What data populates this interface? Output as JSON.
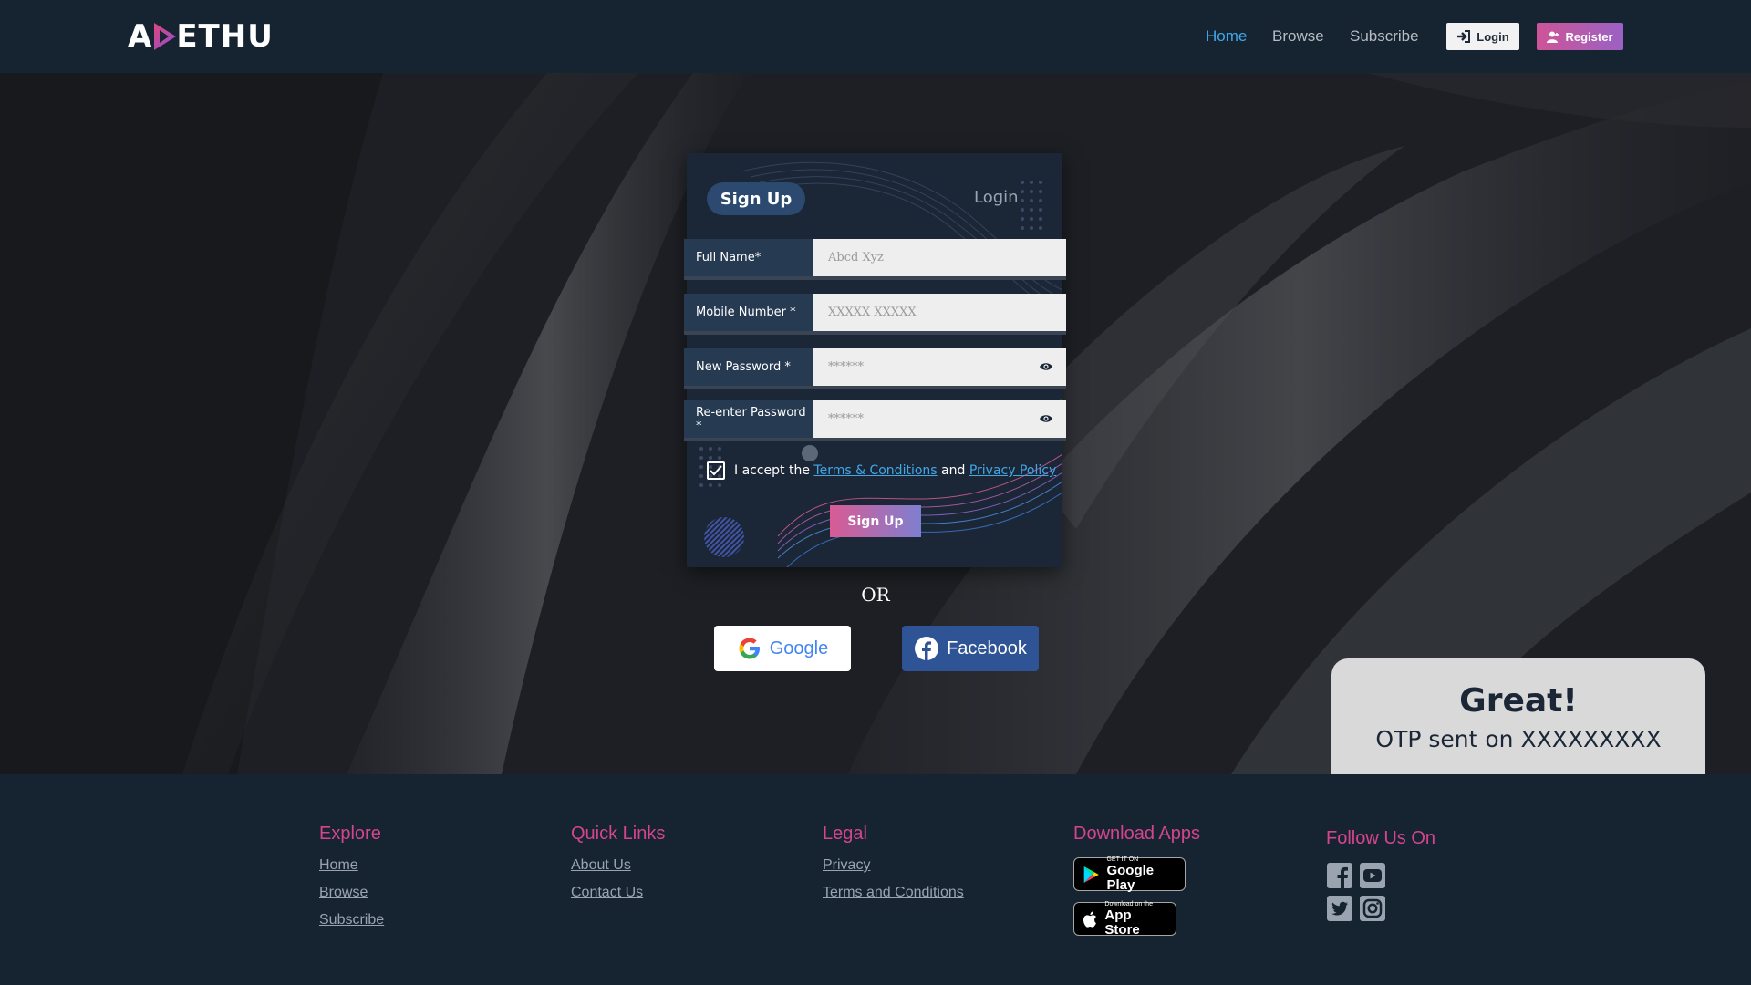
{
  "header": {
    "logo_text_left": "A",
    "logo_text_right": "ETHU",
    "nav": [
      {
        "label": "Home",
        "active": true
      },
      {
        "label": "Browse",
        "active": false
      },
      {
        "label": "Subscribe",
        "active": false
      }
    ],
    "login_label": "Login",
    "register_label": "Register"
  },
  "form": {
    "tab_signup": "Sign Up",
    "tab_login": "Login",
    "fields": [
      {
        "label": "Full Name*",
        "placeholder": "Abcd Xyz"
      },
      {
        "label": "Mobile Number *",
        "placeholder": "XXXXX XXXXX"
      },
      {
        "label": "New Password *",
        "placeholder": "******"
      },
      {
        "label": "Re-enter Password *",
        "placeholder": "******"
      }
    ],
    "terms_prefix": "I accept the",
    "terms_link": "Terms & Conditions",
    "terms_and": "and",
    "privacy_link": "Privacy Policy",
    "checkbox_checked": true,
    "submit_label": "Sign Up"
  },
  "or_text": "OR",
  "social_login": {
    "google_label": "Google",
    "facebook_label": "Facebook"
  },
  "toast": {
    "title": "Great!",
    "message": "OTP sent on XXXXXXXXX"
  },
  "footer": {
    "explore": {
      "title": "Explore",
      "links": [
        "Home",
        "Browse",
        "Subscribe"
      ]
    },
    "quick_links": {
      "title": "Quick Links",
      "links": [
        "About Us",
        "Contact Us"
      ]
    },
    "legal": {
      "title": "Legal",
      "links": [
        "Privacy",
        "Terms and Conditions"
      ]
    },
    "download": {
      "title": "Download Apps",
      "google_play_small": "GET IT ON",
      "google_play_big": "Google Play",
      "app_store_small": "Download on the",
      "app_store_big": "App Store"
    },
    "follow": {
      "title": "Follow Us On",
      "icons": [
        "facebook-icon",
        "youtube-icon",
        "twitter-icon",
        "instagram-icon"
      ]
    }
  },
  "colors": {
    "accent_blue": "#41a8e8",
    "accent_pink": "#d4458d",
    "header_bg": "#162331",
    "card_bg": "#1b2636"
  }
}
